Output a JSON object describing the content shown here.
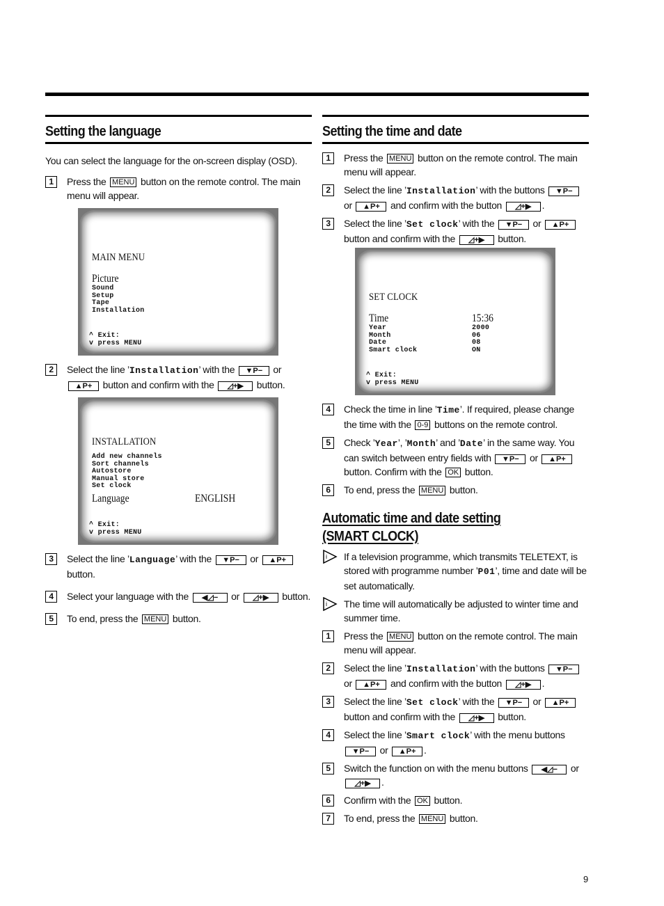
{
  "page_number": "9",
  "keys": {
    "menu": "MENU",
    "p_minus": "▼P−",
    "p_plus": "▲P+",
    "vol_plus": "◿+▶",
    "vol_minus": "◀◿−",
    "digits": "0-9",
    "ok": "OK"
  },
  "language_section": {
    "title": "Setting the language",
    "intro": "You can select the language for the on-screen display (OSD).",
    "steps": [
      {
        "num": "1",
        "a": "Press the",
        "b": "button on the remote control. The main menu will appear."
      },
      {
        "num": "2",
        "a": "Select the line ’",
        "code": "Installation",
        "b": "’ with the",
        "c": "or",
        "d": "button and confirm with the",
        "e": "button."
      },
      {
        "num": "3",
        "a": "Select the line ’",
        "code": "Language",
        "b": "’ with the",
        "c": "or",
        "d": "button."
      },
      {
        "num": "4",
        "a": "Select your language with the",
        "c": "or",
        "d": "button."
      },
      {
        "num": "5",
        "a": "To end, press the",
        "b": "button."
      }
    ],
    "screen_main_menu": {
      "title": "MAIN MENU",
      "selected": "Picture",
      "items": [
        "Sound",
        "Setup",
        "Tape",
        "Installation"
      ],
      "footer_1": "^ Exit:",
      "footer_2": "v press MENU"
    },
    "screen_installation": {
      "title": "INSTALLATION",
      "items": [
        "Add new channels",
        "Sort channels",
        "Autostore",
        "Manual store",
        "Set clock"
      ],
      "selected_label": "Language",
      "selected_value": "ENGLISH",
      "footer_1": "^ Exit:",
      "footer_2": "v press MENU"
    }
  },
  "time_section": {
    "title": "Setting the time and date",
    "steps": [
      {
        "num": "1",
        "a": "Press the",
        "b": "button on the remote control. The main menu will appear."
      },
      {
        "num": "2",
        "a": "Select the line ’",
        "code": "Installation",
        "b": "’ with the buttons",
        "c": "or",
        "d": "and confirm with the button",
        "e": "."
      },
      {
        "num": "3",
        "a": "Select the line ’",
        "code": "Set clock",
        "b": "’ with the",
        "c": "or",
        "d": "button and confirm with the",
        "e": "button."
      },
      {
        "num": "4",
        "a": "Check the time in line ’",
        "code": "Time",
        "b": "’. If required, please change the time with the",
        "c": "buttons on the remote control."
      },
      {
        "num": "5",
        "a": "Check ’",
        "code1": "Year",
        "s1": "’, ’",
        "code2": "Month",
        "s2": "’ and ’",
        "code3": "Date",
        "b": "’ in the same way. You can switch between entry fields with",
        "c": "or",
        "d": "button. Confirm with the",
        "e": "button."
      },
      {
        "num": "6",
        "a": "To end, press the",
        "b": "button."
      }
    ],
    "screen_set_clock": {
      "title": "SET CLOCK",
      "selected_label": "Time",
      "selected_value": "15:36",
      "rows": [
        {
          "label": "Year",
          "value": "2000"
        },
        {
          "label": "Month",
          "value": "06"
        },
        {
          "label": "Date",
          "value": "08"
        },
        {
          "label": "Smart clock",
          "value": "ON"
        }
      ],
      "footer_1": "^ Exit:",
      "footer_2": "v press MENU"
    }
  },
  "smart_clock_section": {
    "title_line1": "Automatic time and date setting",
    "title_line2": "(SMART CLOCK)",
    "notes": [
      {
        "a": "If a television programme, which transmits TELETEXT, is stored with programme number ’",
        "code": "P01",
        "b": "’, time and date will be set automatically."
      },
      {
        "a": "The time will automatically be adjusted to winter time and summer time."
      }
    ],
    "steps": [
      {
        "num": "1",
        "a": "Press the",
        "b": "button on the remote control. The main menu will appear."
      },
      {
        "num": "2",
        "a": "Select the line ’",
        "code": "Installation",
        "b": "’ with the buttons",
        "c": "or",
        "d": "and confirm with the button",
        "e": "."
      },
      {
        "num": "3",
        "a": "Select the line ’",
        "code": "Set clock",
        "b": "’ with the",
        "c": "or",
        "d": "button and confirm with the",
        "e": "button."
      },
      {
        "num": "4",
        "a": "Select the line ’",
        "code": "Smart clock",
        "b": "’ with the menu buttons",
        "c": "or",
        "d": "."
      },
      {
        "num": "5",
        "a": "Switch the function on with the menu buttons",
        "c": "or",
        "d": "."
      },
      {
        "num": "6",
        "a": "Confirm with the",
        "b": "button."
      },
      {
        "num": "7",
        "a": "To end, press the",
        "b": "button."
      }
    ]
  }
}
